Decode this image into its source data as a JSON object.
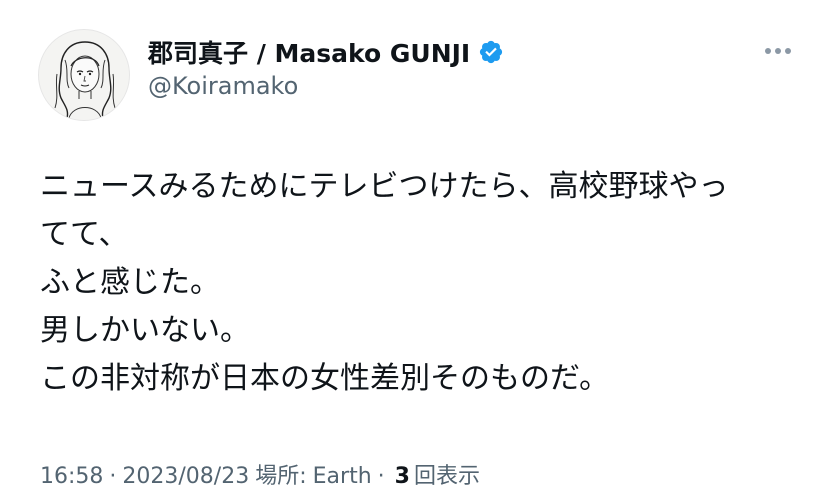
{
  "author": {
    "display_name": "郡司真子 / Masako GUNJI",
    "handle": "@Koiramako",
    "avatar_icon": "illustrated-portrait-avatar",
    "verified_icon": "verified-badge-icon"
  },
  "menu": {
    "icon": "more-options-icon"
  },
  "tweet": {
    "lines": [
      "ニュースみるためにテレビつけたら、高校野球やっ",
      "てて、",
      "ふと感じた。",
      "男しかいない。",
      "この非対称が日本の女性差別そのものだ。"
    ]
  },
  "meta": {
    "time": "16:58",
    "separator_1": "·",
    "date": "2023/08/23",
    "location_label": "場所:",
    "location": "Earth",
    "separator_2": "·",
    "view_count": "3",
    "view_label": "回表示"
  },
  "colors": {
    "verified": "#1d9bf0",
    "secondary_text": "#536471",
    "primary_text": "#0f1419"
  }
}
